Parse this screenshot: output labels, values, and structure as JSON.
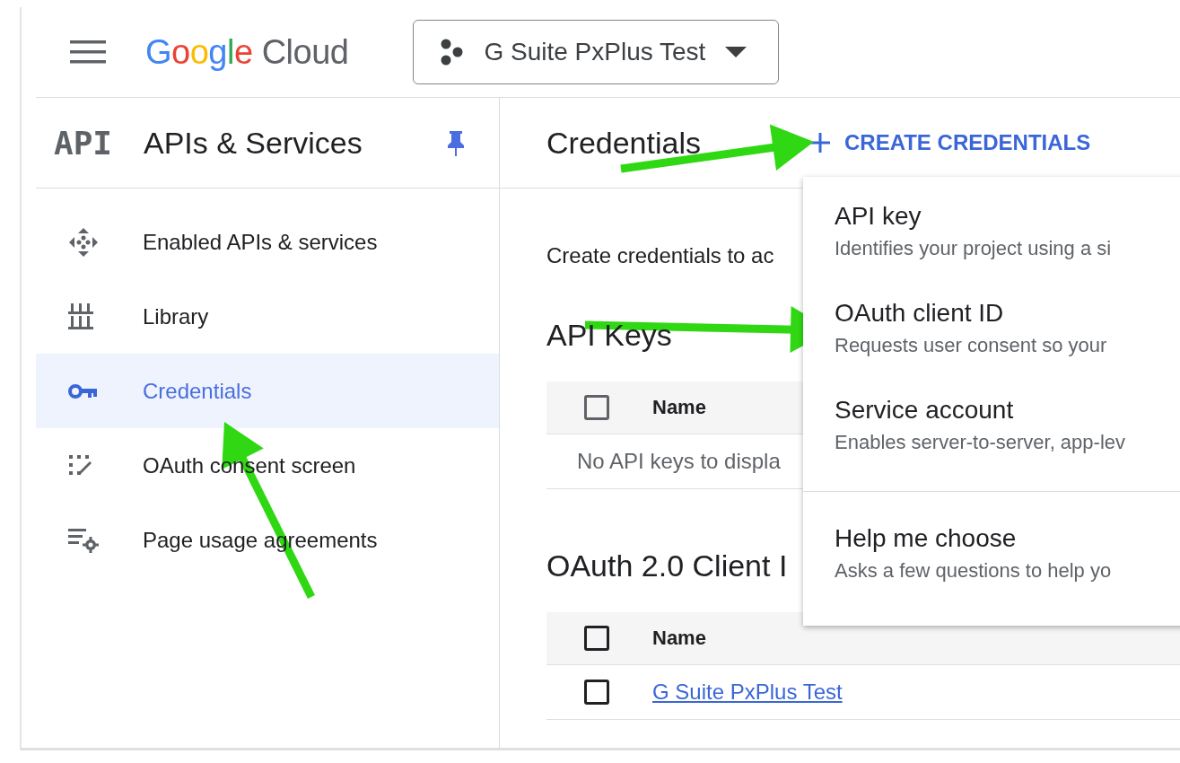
{
  "topbar": {
    "logo": {
      "brand": "Google",
      "product": "Cloud"
    },
    "project": "G Suite PxPlus Test"
  },
  "sidebar": {
    "badge": "API",
    "title": "APIs & Services",
    "pinned": true,
    "items": [
      {
        "label": "Enabled APIs & services",
        "selected": false
      },
      {
        "label": "Library",
        "selected": false
      },
      {
        "label": "Credentials",
        "selected": true
      },
      {
        "label": "OAuth consent screen",
        "selected": false
      },
      {
        "label": "Page usage agreements",
        "selected": false
      }
    ]
  },
  "page": {
    "title": "Credentials",
    "action": "CREATE CREDENTIALS",
    "intro": "Create credentials to ac",
    "sections": [
      {
        "title": "API Keys",
        "header": {
          "label": "Name",
          "checked": false
        },
        "empty": "No API keys to displa"
      },
      {
        "title": "OAuth 2.0 Client I",
        "header": {
          "label": "Name",
          "checked": false
        },
        "rows": [
          {
            "name": "G Suite PxPlus Test",
            "checked": false
          }
        ]
      }
    ]
  },
  "menu": {
    "groups": [
      [
        {
          "title": "API key",
          "description": "Identifies your project using a si"
        },
        {
          "title": "OAuth client ID",
          "description": "Requests user consent so your"
        },
        {
          "title": "Service account",
          "description": "Enables server-to-server, app-lev"
        }
      ],
      [
        {
          "title": "Help me choose",
          "description": "Asks a few questions to help yo"
        }
      ]
    ]
  }
}
